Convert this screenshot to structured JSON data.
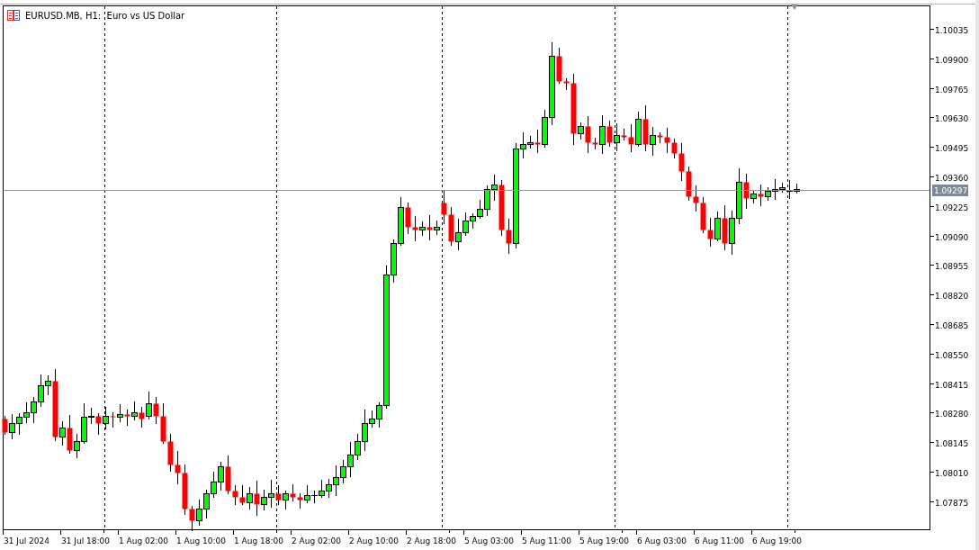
{
  "chart": {
    "title": "EURUSD.MB, H1:  Euro vs US Dollar",
    "price_labels": [
      "1.10035",
      "1.09900",
      "1.09765",
      "1.09630",
      "1.09495",
      "1.09360",
      "1.09225",
      "1.09090",
      "1.08955",
      "1.08820",
      "1.08685",
      "1.08550",
      "1.08415",
      "1.08280",
      "1.08145",
      "1.08010",
      "1.07875"
    ],
    "current_price": "1.09297",
    "time_labels": [
      "31 Jul 2024",
      "31 Jul 18:00",
      "1 Aug 02:00",
      "1 Aug 10:00",
      "1 Aug 18:00",
      "2 Aug 02:00",
      "2 Aug 10:00",
      "2 Aug 18:00",
      "5 Aug 03:00",
      "5 Aug 11:00",
      "5 Aug 19:00",
      "6 Aug 03:00",
      "6 Aug 11:00",
      "6 Aug 19:00"
    ]
  }
}
